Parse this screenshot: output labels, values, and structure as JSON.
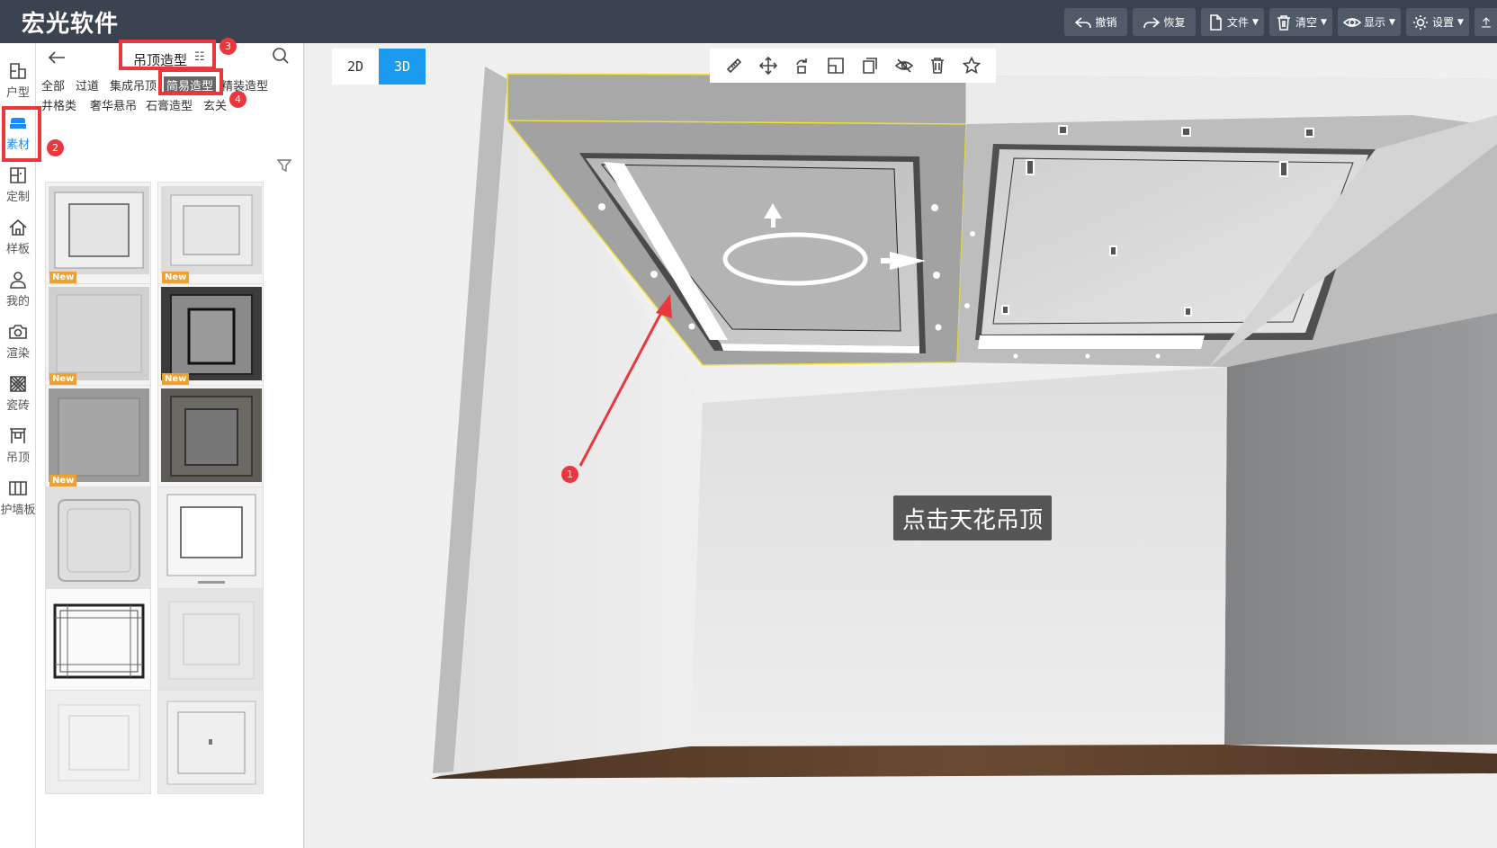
{
  "app": {
    "title": "宏光软件"
  },
  "toolbar": {
    "undo": "撤销",
    "redo": "恢复",
    "file": "文件",
    "clear": "清空",
    "display": "显示",
    "settings": "设置"
  },
  "rail": [
    {
      "label": "户型",
      "icon": "floorplan-icon"
    },
    {
      "label": "素材",
      "icon": "sofa-icon"
    },
    {
      "label": "定制",
      "icon": "cabinet-icon"
    },
    {
      "label": "样板",
      "icon": "house-icon"
    },
    {
      "label": "我的",
      "icon": "user-icon"
    },
    {
      "label": "渲染",
      "icon": "camera-icon"
    },
    {
      "label": "瓷砖",
      "icon": "tile-icon"
    },
    {
      "label": "吊顶",
      "icon": "ceiling-icon"
    },
    {
      "label": "护墙板",
      "icon": "wainscot-icon"
    }
  ],
  "panel": {
    "title": "吊顶造型",
    "title_icon": "☷",
    "categories_row1": [
      "全部",
      "过道",
      "集成吊顶",
      "简易造型",
      "精装造型"
    ],
    "categories_row2": [
      "井格类",
      "奢华悬吊",
      "石膏造型",
      "玄关"
    ],
    "selected_category": "简易造型",
    "new_tag": "New",
    "thumbnails": [
      {
        "new": true
      },
      {
        "new": true
      },
      {
        "new": true
      },
      {
        "new": true
      },
      {
        "new": true
      },
      {
        "new": false
      },
      {
        "new": false
      },
      {
        "new": false
      },
      {
        "new": false
      },
      {
        "new": false
      },
      {
        "new": false
      },
      {
        "new": false
      }
    ]
  },
  "steps": {
    "one": "1",
    "two": "2",
    "three": "3",
    "four": "4"
  },
  "viewport": {
    "mode_2d": "2D",
    "mode_3d": "3D",
    "active_mode": "3D",
    "callout": "点击天花吊顶"
  },
  "colors": {
    "accent": "#1a9bf0",
    "highlight": "#e8383d",
    "topbar": "#3b4350",
    "selection": "#f0e030"
  }
}
